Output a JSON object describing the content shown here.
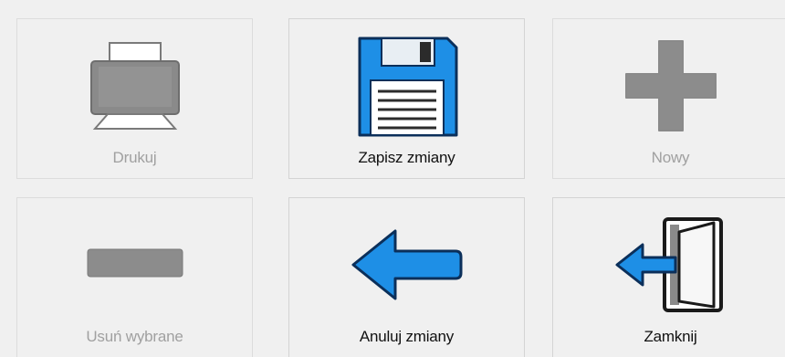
{
  "buttons": {
    "print": {
      "label": "Drukuj",
      "icon": "printer-icon",
      "enabled": false
    },
    "save": {
      "label": "Zapisz zmiany",
      "icon": "floppy-disk-icon",
      "enabled": true
    },
    "new": {
      "label": "Nowy",
      "icon": "plus-icon",
      "enabled": false
    },
    "delete": {
      "label": "Usuń wybrane",
      "icon": "minus-icon",
      "enabled": false
    },
    "cancel": {
      "label": "Anuluj zmiany",
      "icon": "arrow-left-icon",
      "enabled": true
    },
    "close": {
      "label": "Zamknij",
      "icon": "exit-door-icon",
      "enabled": true
    }
  },
  "colors": {
    "accent_blue": "#1e8fe6",
    "disabled_gray": "#8a8a8a",
    "disabled_text": "#a0a0a0",
    "background": "#f0f0f0"
  }
}
